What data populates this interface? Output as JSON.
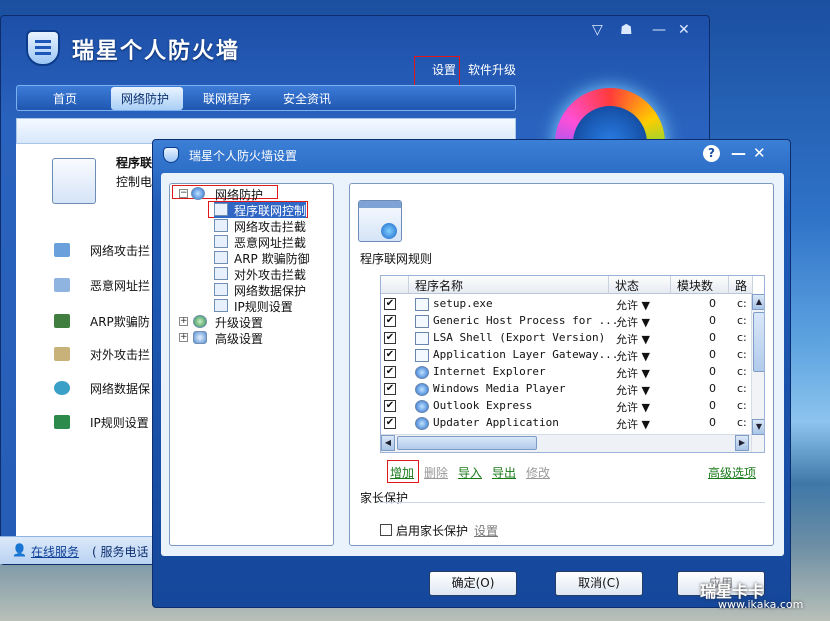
{
  "main_window": {
    "title": "瑞星个人防火墙",
    "top_links": [
      "设置",
      "软件升级"
    ],
    "nav": [
      "首页",
      "网络防护",
      "联网程序",
      "安全资讯"
    ],
    "active_nav": "网络防护",
    "panel_heading": "程序联",
    "panel_sub": "控制电",
    "side_items": [
      "网络攻击拦",
      "恶意网址拦",
      "ARP欺骗防",
      "对外攻击拦",
      "网络数据保",
      "IP规则设置"
    ],
    "footer": {
      "online": "在线服务",
      "phone": "( 服务电话"
    }
  },
  "dialog": {
    "title": "瑞星个人防火墙设置",
    "controls": {
      "help": "?",
      "minimize": "—",
      "close": "✕"
    },
    "tree": {
      "root": "网络防护",
      "children": [
        "程序联网控制",
        "网络攻击拦截",
        "恶意网址拦截",
        "ARP 欺骗防御",
        "对外攻击拦截",
        "网络数据保护",
        "IP规则设置"
      ],
      "others": [
        "升级设置",
        "高级设置"
      ],
      "expand_minus": "−",
      "expand_plus": "+"
    },
    "section_label": "程序联网规则",
    "table": {
      "headers": [
        "程序名称",
        "状态",
        "模块数",
        "路"
      ],
      "rows": [
        {
          "name": "setup.exe",
          "status": "允许 ▼",
          "modules": "0",
          "path": "c:"
        },
        {
          "name": "Generic Host Process for ...",
          "status": "允许 ▼",
          "modules": "0",
          "path": "c:"
        },
        {
          "name": "LSA Shell (Export Version)",
          "status": "允许 ▼",
          "modules": "0",
          "path": "c:"
        },
        {
          "name": "Application Layer Gateway...",
          "status": "允许 ▼",
          "modules": "0",
          "path": "c:"
        },
        {
          "name": "Internet Explorer",
          "status": "允许 ▼",
          "modules": "0",
          "path": "c:"
        },
        {
          "name": "Windows Media Player",
          "status": "允许 ▼",
          "modules": "0",
          "path": "c:"
        },
        {
          "name": "Outlook Express",
          "status": "允许 ▼",
          "modules": "0",
          "path": "c:"
        },
        {
          "name": "Updater Application",
          "status": "允许 ▼",
          "modules": "0",
          "path": "c:"
        }
      ],
      "checkmark": "✔"
    },
    "actions": {
      "add": "增加",
      "delete": "删除",
      "import": "导入",
      "export": "导出",
      "edit": "修改",
      "advanced": "高级选项"
    },
    "parental": {
      "heading": "家长保护",
      "checkbox_label": "启用家长保护",
      "settings_link": "设置"
    },
    "buttons": {
      "ok": "确定(O)",
      "cancel": "取消(C)",
      "apply": "应用"
    }
  },
  "watermark": {
    "brand": "瑞星卡卡",
    "url": "www.ikaka.com"
  },
  "colors": {
    "accent": "#1f5cb8",
    "link_green": "#1a7a1a",
    "highlight": "#e01818"
  }
}
